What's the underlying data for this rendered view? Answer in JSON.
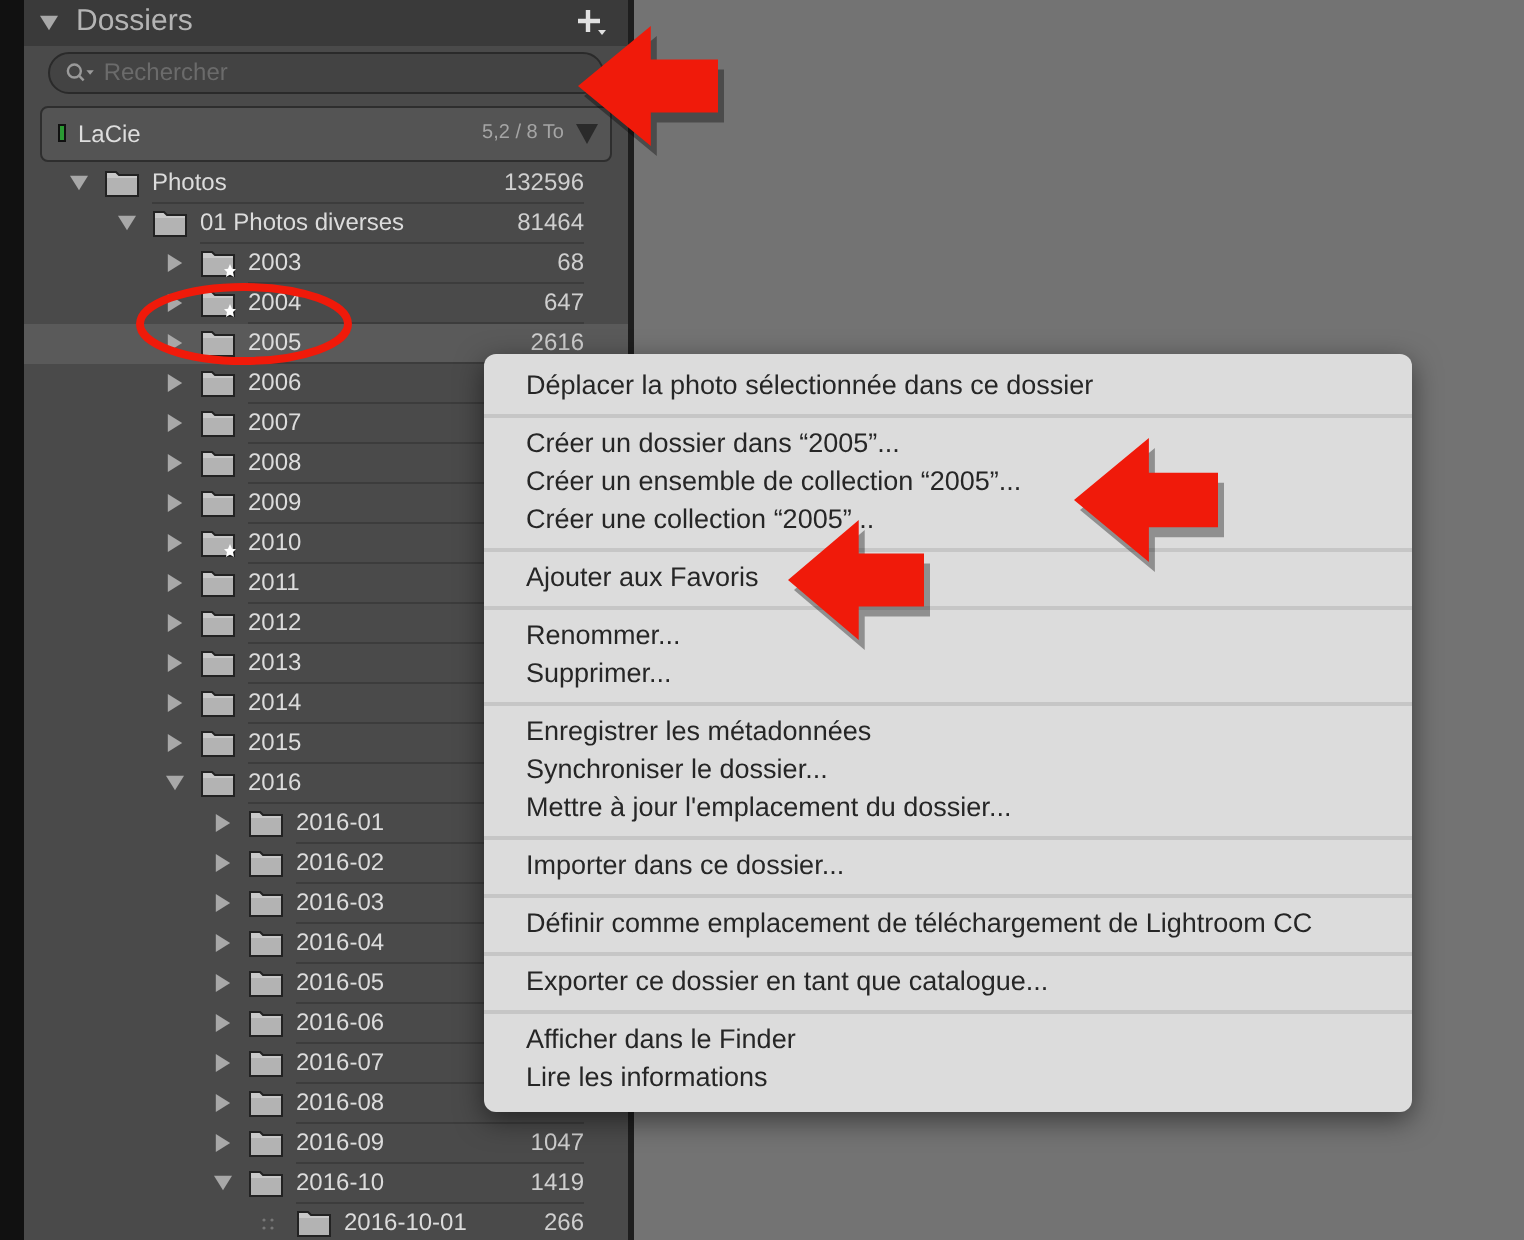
{
  "panel": {
    "title": "Dossiers",
    "expanded": true
  },
  "search": {
    "placeholder": "Rechercher"
  },
  "volume": {
    "name": "LaCie",
    "usage": "5,2 / 8 To"
  },
  "tree": [
    {
      "label": "Photos",
      "count": "132596",
      "expanded": true,
      "selected": false,
      "starred": false,
      "children": [
        {
          "label": "01 Photos diverses",
          "count": "81464",
          "expanded": true,
          "selected": false,
          "starred": false,
          "children": [
            {
              "label": "2003",
              "count": "68",
              "expanded": false,
              "selected": false,
              "starred": true
            },
            {
              "label": "2004",
              "count": "647",
              "expanded": false,
              "selected": false,
              "starred": true
            },
            {
              "label": "2005",
              "count": "2616",
              "expanded": false,
              "selected": true,
              "starred": false
            },
            {
              "label": "2006",
              "expanded": false,
              "selected": false,
              "starred": false
            },
            {
              "label": "2007",
              "expanded": false,
              "selected": false,
              "starred": false
            },
            {
              "label": "2008",
              "expanded": false,
              "selected": false,
              "starred": false
            },
            {
              "label": "2009",
              "expanded": false,
              "selected": false,
              "starred": false
            },
            {
              "label": "2010",
              "expanded": false,
              "selected": false,
              "starred": true
            },
            {
              "label": "2011",
              "expanded": false,
              "selected": false,
              "starred": false
            },
            {
              "label": "2012",
              "expanded": false,
              "selected": false,
              "starred": false
            },
            {
              "label": "2013",
              "expanded": false,
              "selected": false,
              "starred": false
            },
            {
              "label": "2014",
              "expanded": false,
              "selected": false,
              "starred": false
            },
            {
              "label": "2015",
              "expanded": false,
              "selected": false,
              "starred": false
            },
            {
              "label": "2016",
              "expanded": true,
              "selected": false,
              "starred": false,
              "children": [
                {
                  "label": "2016-01",
                  "expanded": false,
                  "selected": false,
                  "starred": false
                },
                {
                  "label": "2016-02",
                  "expanded": false,
                  "selected": false,
                  "starred": false
                },
                {
                  "label": "2016-03",
                  "expanded": false,
                  "selected": false,
                  "starred": false
                },
                {
                  "label": "2016-04",
                  "expanded": false,
                  "selected": false,
                  "starred": false
                },
                {
                  "label": "2016-05",
                  "expanded": false,
                  "selected": false,
                  "starred": false
                },
                {
                  "label": "2016-06",
                  "expanded": false,
                  "selected": false,
                  "starred": false
                },
                {
                  "label": "2016-07",
                  "expanded": false,
                  "selected": false,
                  "starred": false
                },
                {
                  "label": "2016-08",
                  "expanded": false,
                  "selected": false,
                  "starred": false
                },
                {
                  "label": "2016-09",
                  "count": "1047",
                  "expanded": false,
                  "selected": false,
                  "starred": false
                },
                {
                  "label": "2016-10",
                  "count": "1419",
                  "expanded": true,
                  "selected": false,
                  "starred": false,
                  "children": [
                    {
                      "label": "2016-10-01",
                      "count": "266",
                      "selected": false,
                      "starred": false
                    }
                  ]
                }
              ]
            }
          ]
        }
      ]
    }
  ],
  "context_menu": [
    [
      "Déplacer la photo sélectionnée dans ce dossier"
    ],
    [
      "Créer un dossier dans “2005”...",
      "Créer un ensemble de collection “2005”...",
      "Créer une collection “2005”..."
    ],
    [
      "Ajouter aux Favoris"
    ],
    [
      "Renommer...",
      "Supprimer..."
    ],
    [
      "Enregistrer les métadonnées",
      "Synchroniser le dossier...",
      "Mettre à jour l'emplacement du dossier..."
    ],
    [
      "Importer dans ce dossier..."
    ],
    [
      "Définir comme emplacement de téléchargement de Lightroom CC"
    ],
    [
      "Exporter ce dossier en tant que catalogue..."
    ],
    [
      "Afficher dans le Finder",
      "Lire les informations"
    ]
  ]
}
